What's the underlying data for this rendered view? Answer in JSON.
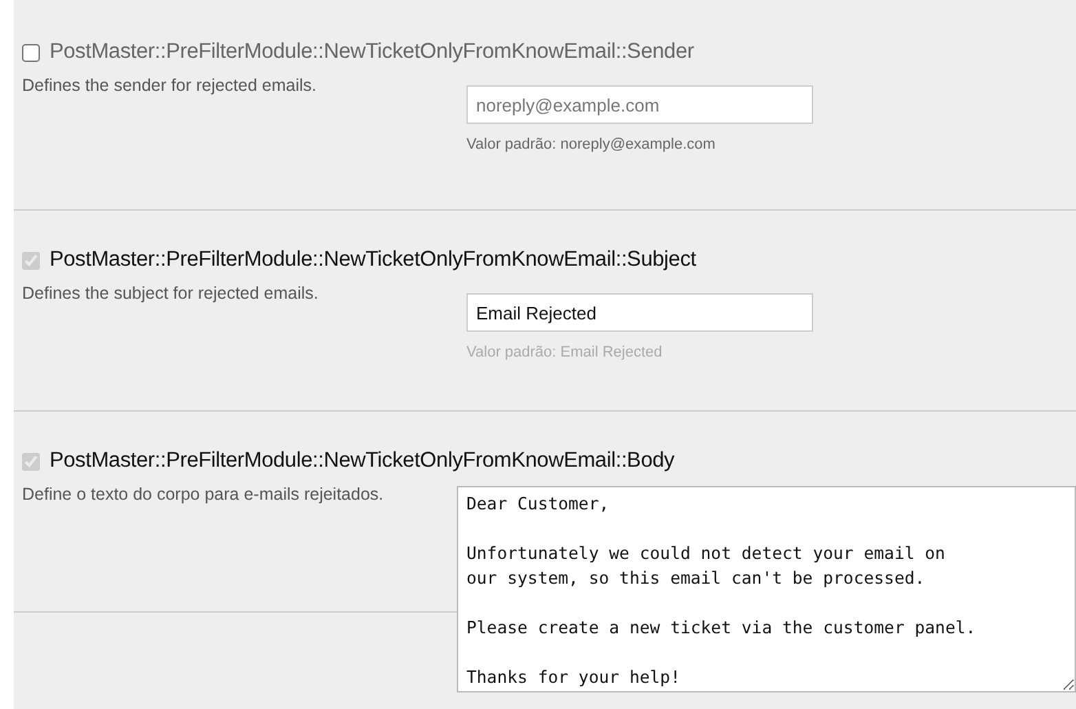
{
  "settings": [
    {
      "kind": "input",
      "checked": false,
      "title": "PostMaster::PreFilterModule::NewTicketOnlyFromKnowEmail::Sender",
      "description": "Defines the sender for rejected emails.",
      "value": "noreply@example.com",
      "default": "Valor padrão: noreply@example.com"
    },
    {
      "kind": "input",
      "checked": true,
      "title": "PostMaster::PreFilterModule::NewTicketOnlyFromKnowEmail::Subject",
      "description": "Defines the subject for rejected emails.",
      "value": "Email Rejected",
      "default": "Valor padrão: Email Rejected"
    },
    {
      "kind": "textarea",
      "checked": true,
      "title": "PostMaster::PreFilterModule::NewTicketOnlyFromKnowEmail::Body",
      "description": "Define o texto do corpo para e-mails rejeitados.",
      "value": "Dear Customer,\n\nUnfortunately we could not detect your email on\nour system, so this email can't be processed.\n\nPlease create a new ticket via the customer panel.\n\nThanks for your help!"
    }
  ]
}
